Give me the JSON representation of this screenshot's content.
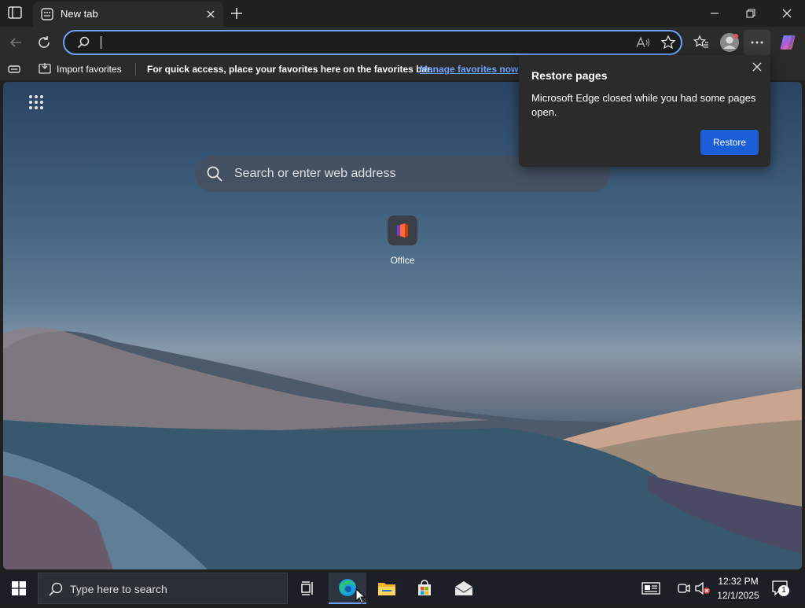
{
  "titlebar": {
    "tab_title": "New tab",
    "icons": [
      "tab-actions-icon",
      "newtab-page-icon",
      "close-icon",
      "plus-icon",
      "minimize-icon",
      "restore-icon",
      "close-window-icon"
    ]
  },
  "navbar": {
    "address_value": "",
    "icons": [
      "back-icon",
      "refresh-icon",
      "search-icon",
      "read-aloud-icon",
      "favorite-star-icon",
      "favorites-list-icon",
      "profile-icon",
      "more-icon",
      "copilot-icon"
    ]
  },
  "favbar": {
    "import_label": "Import favorites",
    "message": "For quick access, place your favorites here on the favorites bar.",
    "manage_link": "Manage favorites now"
  },
  "content": {
    "search_placeholder": "Search or enter web address",
    "tiles": [
      {
        "label": "Office"
      }
    ]
  },
  "popup": {
    "title": "Restore pages",
    "body": "Microsoft Edge closed while you had some pages open.",
    "button": "Restore",
    "accent": "#1a5fd8"
  },
  "taskbar": {
    "search_placeholder": "Type here to search",
    "time": "12:32 PM",
    "date": "12/1/2025",
    "notification_count": "1"
  }
}
